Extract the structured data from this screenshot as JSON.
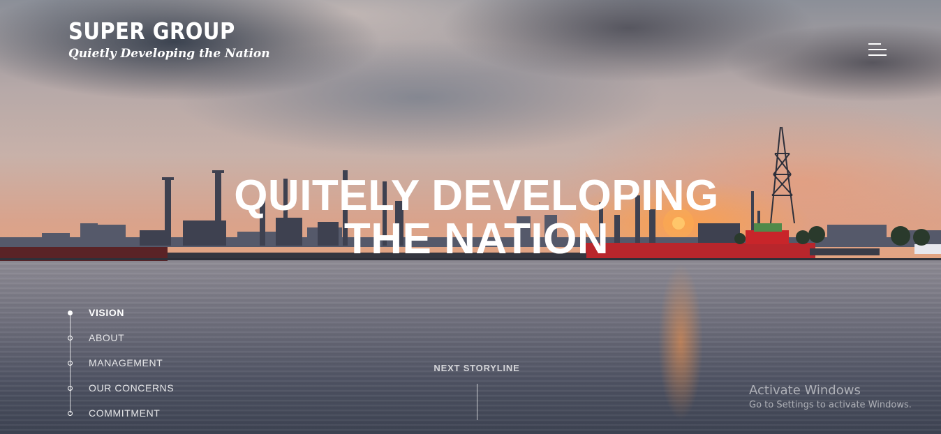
{
  "brand": {
    "name": "SUPER GROUP",
    "tagline": "Quietly Developing the Nation"
  },
  "header": {
    "menu_icon": "hamburger-menu-icon"
  },
  "hero": {
    "title_line1": "QUITELY DEVELOPING",
    "title_line2": "THE NATION"
  },
  "side_nav": {
    "items": [
      {
        "label": "VISION",
        "active": true
      },
      {
        "label": "ABOUT",
        "active": false
      },
      {
        "label": "MANAGEMENT",
        "active": false
      },
      {
        "label": "OUR CONCERNS",
        "active": false
      },
      {
        "label": "COMMITMENT",
        "active": false
      }
    ]
  },
  "next_storyline": {
    "label": "NEXT STORYLINE"
  },
  "windows_watermark": {
    "title": "Activate Windows",
    "subtitle": "Go to Settings to activate Windows."
  },
  "colors": {
    "text": "#ffffff",
    "sunset_accent": "#ff9a40",
    "ship_red": "#c8252a"
  }
}
